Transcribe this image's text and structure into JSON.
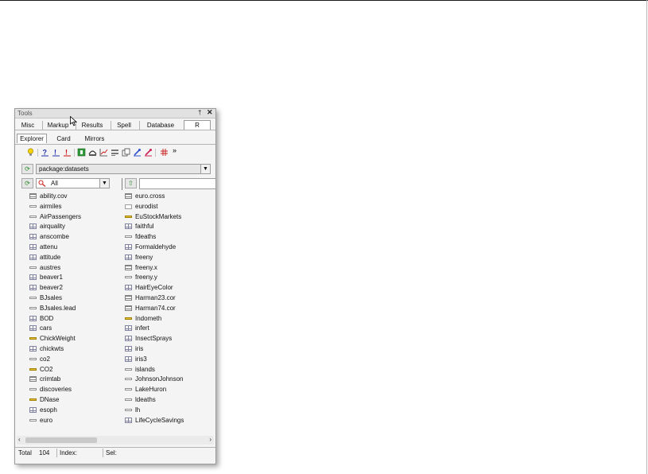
{
  "panel": {
    "title": "Tools",
    "pin_glyph": "†",
    "close_glyph": "✕"
  },
  "tabs": [
    {
      "label": "Misc"
    },
    {
      "label": "Markup"
    },
    {
      "label": "Results"
    },
    {
      "label": "Spell"
    },
    {
      "label": "Database"
    },
    {
      "label": "R"
    }
  ],
  "subtabs": [
    {
      "label": "Explorer"
    },
    {
      "label": "Card"
    },
    {
      "label": "Mirrors"
    }
  ],
  "toolbar": {
    "icons": [
      "lightbulb-icon",
      "help-icon",
      "help-underline-icon",
      "help-red-icon",
      "object-icon",
      "load-icon",
      "plot-icon",
      "edit-icon",
      "copy-icon",
      "brush-icon",
      "brush-red-icon",
      "grid-icon",
      "more-icon"
    ],
    "more_glyph": "»"
  },
  "package": {
    "value": "package:datasets"
  },
  "filter": {
    "value": "All",
    "search_value": ""
  },
  "items": [
    {
      "label": "ability.cov",
      "icon": "list"
    },
    {
      "label": "airmiles",
      "icon": "ts"
    },
    {
      "label": "AirPassengers",
      "icon": "ts"
    },
    {
      "label": "airquality",
      "icon": "df"
    },
    {
      "label": "anscombe",
      "icon": "df"
    },
    {
      "label": "attenu",
      "icon": "df"
    },
    {
      "label": "attitude",
      "icon": "df"
    },
    {
      "label": "austres",
      "icon": "ts"
    },
    {
      "label": "beaver1",
      "icon": "df"
    },
    {
      "label": "beaver2",
      "icon": "df"
    },
    {
      "label": "BJsales",
      "icon": "ts"
    },
    {
      "label": "BJsales.lead",
      "icon": "ts"
    },
    {
      "label": "BOD",
      "icon": "df"
    },
    {
      "label": "cars",
      "icon": "df"
    },
    {
      "label": "ChickWeight",
      "icon": "mts"
    },
    {
      "label": "chickwts",
      "icon": "df"
    },
    {
      "label": "co2",
      "icon": "ts"
    },
    {
      "label": "CO2",
      "icon": "mts"
    },
    {
      "label": "crimtab",
      "icon": "mat"
    },
    {
      "label": "discoveries",
      "icon": "ts"
    },
    {
      "label": "DNase",
      "icon": "mts"
    },
    {
      "label": "esoph",
      "icon": "df"
    },
    {
      "label": "euro",
      "icon": "ts"
    },
    {
      "label": "euro.cross",
      "icon": "mat"
    },
    {
      "label": "eurodist",
      "icon": "dist"
    },
    {
      "label": "EuStockMarkets",
      "icon": "mts"
    },
    {
      "label": "faithful",
      "icon": "df"
    },
    {
      "label": "fdeaths",
      "icon": "ts"
    },
    {
      "label": "Formaldehyde",
      "icon": "df"
    },
    {
      "label": "freeny",
      "icon": "df"
    },
    {
      "label": "freeny.x",
      "icon": "mat"
    },
    {
      "label": "freeny.y",
      "icon": "ts"
    },
    {
      "label": "HairEyeColor",
      "icon": "df"
    },
    {
      "label": "Harman23.cor",
      "icon": "list"
    },
    {
      "label": "Harman74.cor",
      "icon": "list"
    },
    {
      "label": "Indometh",
      "icon": "mts"
    },
    {
      "label": "infert",
      "icon": "df"
    },
    {
      "label": "InsectSprays",
      "icon": "df"
    },
    {
      "label": "iris",
      "icon": "df"
    },
    {
      "label": "iris3",
      "icon": "df"
    },
    {
      "label": "islands",
      "icon": "ts"
    },
    {
      "label": "JohnsonJohnson",
      "icon": "ts"
    },
    {
      "label": "LakeHuron",
      "icon": "ts"
    },
    {
      "label": "ldeaths",
      "icon": "ts"
    },
    {
      "label": "lh",
      "icon": "ts"
    },
    {
      "label": "LifeCycleSavings",
      "icon": "df"
    }
  ],
  "status": {
    "total_label": "Total",
    "total_value": "104",
    "index_label": "Index:",
    "sel_label": "Sel:"
  },
  "colors": {
    "panel_bg": "#f4f4f4",
    "border": "#9a9a9a",
    "matrix_icon": "#8080a0",
    "mts_icon": "#e8c33a"
  }
}
